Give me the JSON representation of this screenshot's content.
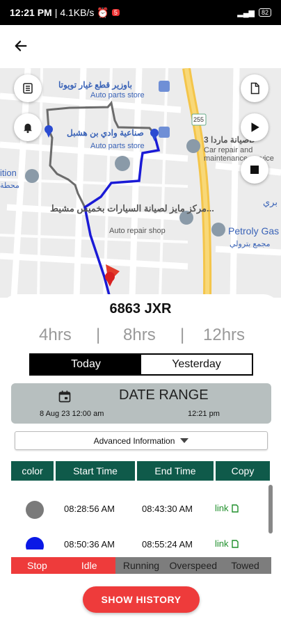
{
  "status_bar": {
    "time": "12:21 PM",
    "network_speed": "4.1KB/s",
    "separator": "|",
    "badge": "5",
    "battery": "82"
  },
  "map": {
    "places": [
      {
        "name": "باوزير قطع غيار تويوتا",
        "category": "Auto parts store"
      },
      {
        "name": "صناعية وادي بن هشبل",
        "category": "Auto parts store"
      },
      {
        "name": "مركز مايز لصيانة السيارات بخميس مشيط...",
        "category": "Auto repair shop"
      },
      {
        "name": "صيانة ماردا 3D",
        "category": "Car repair and maintenance service"
      },
      {
        "name": "Petroly Gas",
        "category": "مجمع بترولي"
      },
      {
        "name": "ition",
        "category": "محطة"
      },
      {
        "name": "بري",
        "category": ""
      }
    ],
    "road_shield": "255"
  },
  "vehicle": {
    "plate": "6863 JXR"
  },
  "hour_options": [
    "4hrs",
    "8hrs",
    "12hrs"
  ],
  "hour_separator": "|",
  "day_toggle": {
    "today": "Today",
    "yesterday": "Yesterday",
    "selected": "Today"
  },
  "date_range": {
    "title": "DATE RANGE",
    "start": "8 Aug 23 12:00 am",
    "end": "12:21 pm"
  },
  "advanced": {
    "label": "Advanced Information"
  },
  "table": {
    "headers": [
      "color",
      "Start Time",
      "End Time",
      "Copy"
    ],
    "rows": [
      {
        "color": "#7a7a7a",
        "start": "08:28:56 AM",
        "end": "08:43:30 AM",
        "copy": "link"
      },
      {
        "color": "#0a18e6",
        "start": "08:50:36 AM",
        "end": "08:55:24 AM",
        "copy": "link"
      }
    ]
  },
  "legend": [
    {
      "label": "Stop",
      "color": "#ee3b3b"
    },
    {
      "label": "Idle",
      "color": "#ee3b3b"
    },
    {
      "label": "Running",
      "color": "#7d7d7d"
    },
    {
      "label": "Overspeed",
      "color": "#7d7d7d"
    },
    {
      "label": "Towed",
      "color": "#7d7d7d"
    }
  ],
  "show_history": "SHOW HISTORY"
}
